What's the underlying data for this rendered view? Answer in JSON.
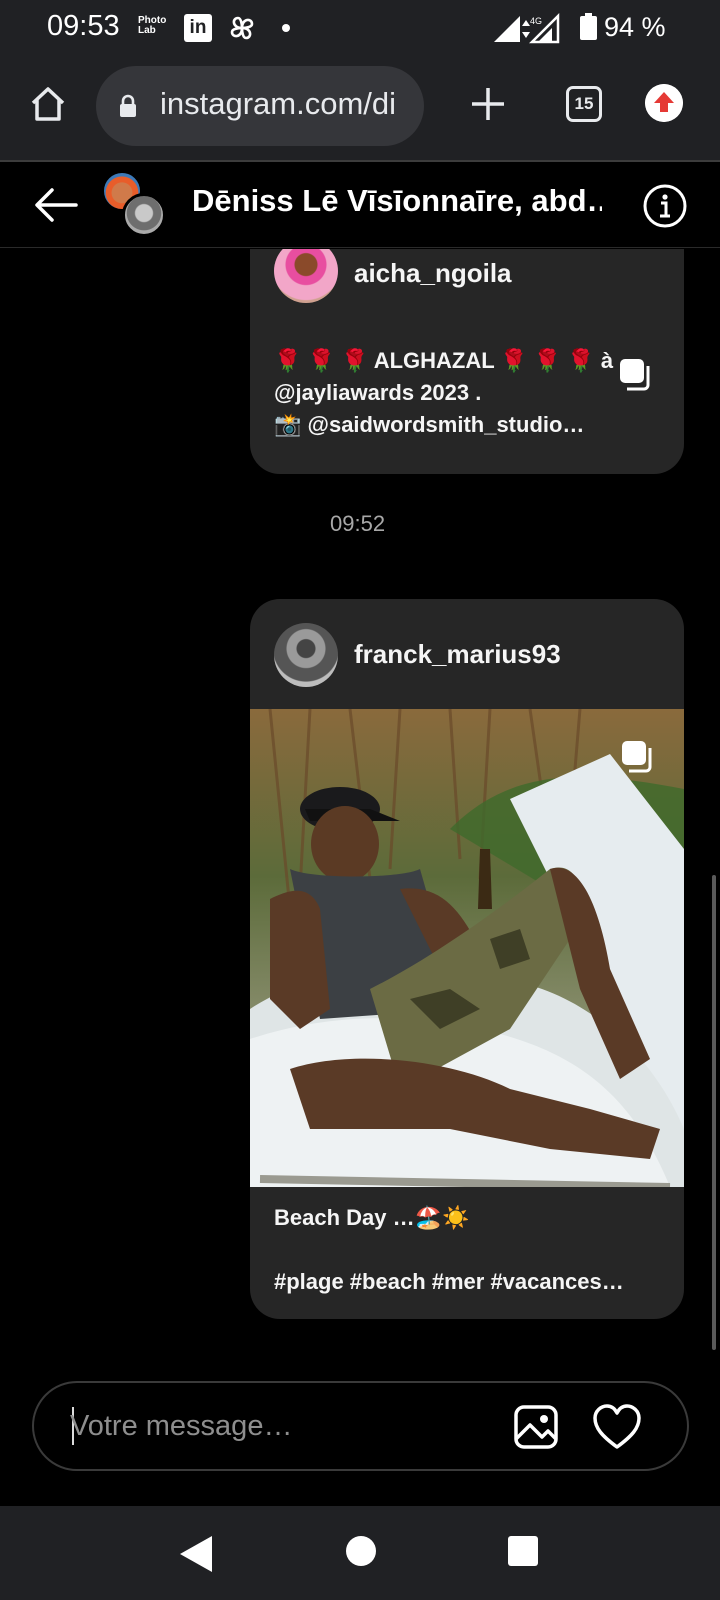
{
  "status_bar": {
    "time": "09:53",
    "photolab_line1": "Photo",
    "photolab_line2": "Lab",
    "linkedin": "in",
    "battery": "94 %",
    "network": "4G"
  },
  "browser": {
    "url": "instagram.com/di",
    "tab_count": "15"
  },
  "chat_header": {
    "title": "Dēniss Lē Vīsīonnaīre, abd…"
  },
  "messages": [
    {
      "username": "aicha_ngoila",
      "caption_line1": "🌹 🌹 🌹 ALGHAZAL 🌹 🌹 🌹 à",
      "caption_line2": "@jayliawards 2023 .",
      "caption_line3": "📸 @saidwordsmith_studio…"
    },
    {
      "timestamp": "09:52"
    },
    {
      "username": "franck_marius93",
      "caption_line1": "Beach Day …🏖️☀️",
      "caption_line2": "#plage #beach #mer #vacances…"
    }
  ],
  "composer": {
    "placeholder": "Votre message…"
  },
  "icons": {
    "home": "home-icon",
    "lock": "lock-icon",
    "new_tab": "plus-icon",
    "tabs": "tab-switcher-icon",
    "update": "upload-arrow-icon",
    "back": "arrow-left-icon",
    "info": "info-icon",
    "multi": "carousel-icon",
    "image": "image-icon",
    "heart": "heart-icon"
  },
  "colors": {
    "bar_bg": "#202124",
    "card_bg": "#262626",
    "update_red": "#e53935"
  }
}
